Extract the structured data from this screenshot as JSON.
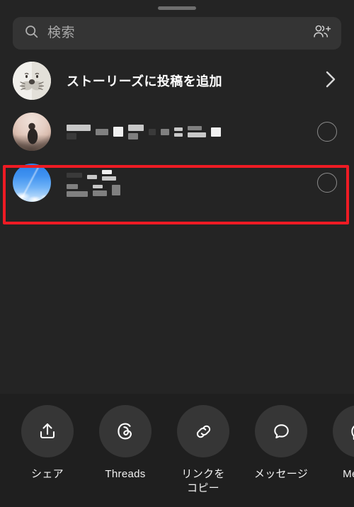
{
  "sheet": {
    "handle": "drag-handle"
  },
  "search": {
    "placeholder": "検索",
    "value": "",
    "icon": "search-icon",
    "action_icon": "add-people-icon"
  },
  "story_row": {
    "label": "ストーリーズに投稿を追加",
    "avatar": "seal-avatar",
    "chevron": "chevron-right-icon"
  },
  "contacts": [
    {
      "avatar": "photo-avatar-person-hill",
      "name_redacted": true,
      "name_lines": 1,
      "selected": false,
      "highlighted": false
    },
    {
      "avatar": "photo-avatar-blue-sky",
      "name_redacted": true,
      "name_lines": 2,
      "selected": false,
      "highlighted": true
    }
  ],
  "highlight": {
    "color": "#ee1b24",
    "target": "contact-row-2"
  },
  "share_tray": {
    "items": [
      {
        "label": "シェア",
        "icon": "share-icon"
      },
      {
        "label": "Threads",
        "icon": "threads-icon"
      },
      {
        "label": "リンクを\nコピー",
        "icon": "link-icon"
      },
      {
        "label": "メッセージ",
        "icon": "message-bubble-icon"
      },
      {
        "label": "Messe",
        "icon": "messenger-icon"
      }
    ]
  },
  "colors": {
    "background": "#242424",
    "search_field": "#343434",
    "tray_background": "#1f1f1f",
    "tray_circle": "#363636",
    "accent_highlight": "#ee1b24",
    "text_primary": "#ffffff",
    "text_muted": "#a8a8a8"
  }
}
